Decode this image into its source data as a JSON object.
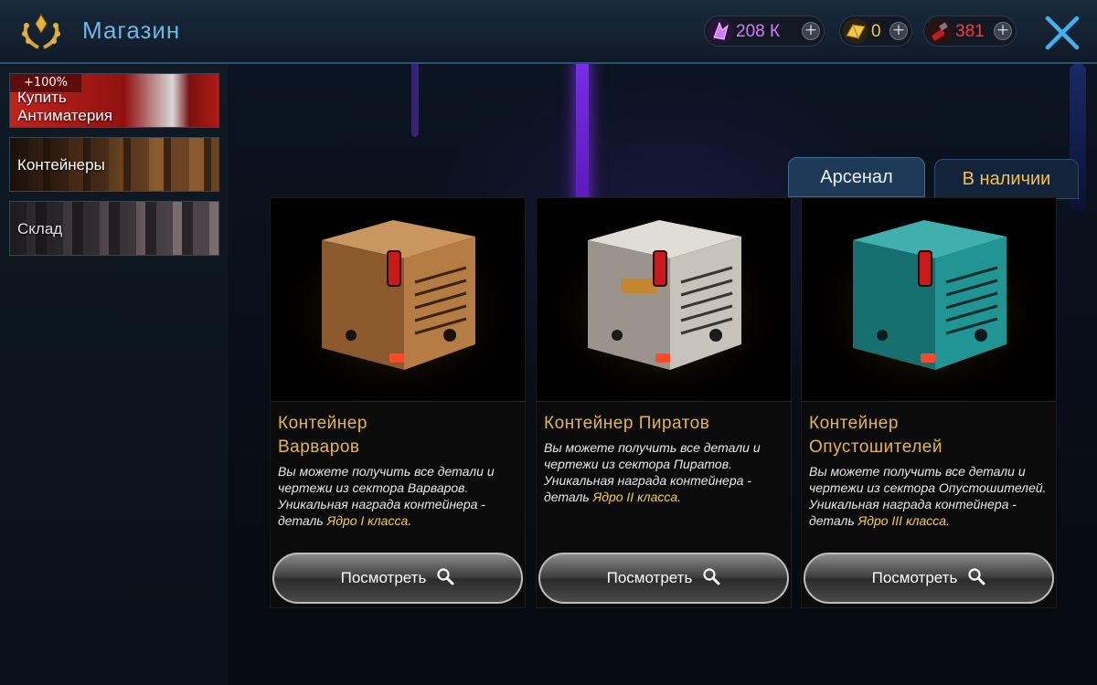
{
  "header": {
    "title": "Магазин",
    "currencies": [
      {
        "name": "antimatter",
        "value": "208 К",
        "color": "#d37bff",
        "icon": "antimatter-crystal-icon"
      },
      {
        "name": "gold",
        "value": "0",
        "color": "#f3c84a",
        "icon": "gold-ingot-icon"
      },
      {
        "name": "fuel",
        "value": "381",
        "color": "#ff3a3a",
        "icon": "red-canister-icon"
      }
    ]
  },
  "sidebar": {
    "items": [
      {
        "label": "Купить\nАнтиматерия",
        "badge": "+100%"
      },
      {
        "label": "Контейнеры"
      },
      {
        "label": "Склад"
      }
    ]
  },
  "tabs": [
    {
      "label": "Арсенал",
      "active": true
    },
    {
      "label": "В наличии",
      "active": false
    }
  ],
  "cards": [
    {
      "title": "Контейнер\nВарваров",
      "desc_text": "Вы можете получить все детали и чертежи из сектора Варваров. Уникальная награда контейнера - деталь ",
      "desc_highlight": "Ядро I класса",
      "desc_end": ".",
      "button": "Посмотреть",
      "color": "#b9824a"
    },
    {
      "title": "Контейнер Пиратов",
      "desc_text": "Вы можете получить все детали и чертежи из сектора Пиратов. Уникальная награда контейнера - деталь ",
      "desc_highlight": "Ядро II класса",
      "desc_end": ".",
      "button": "Посмотреть",
      "color": "#c7c4c0"
    },
    {
      "title": "Контейнер\nОпустошителей",
      "desc_text": "Вы можете получить все детали и чертежи из сектора Опустошителей. Уникальная награда контейнера - деталь ",
      "desc_highlight": "Ядро III класса",
      "desc_end": ".",
      "button": "Посмотреть",
      "color": "#1f8f8f"
    }
  ],
  "colors": {
    "accent_blue": "#6fb6e3",
    "gold_text": "#e6b64c",
    "highlight_yellow": "#f4cc4f"
  }
}
